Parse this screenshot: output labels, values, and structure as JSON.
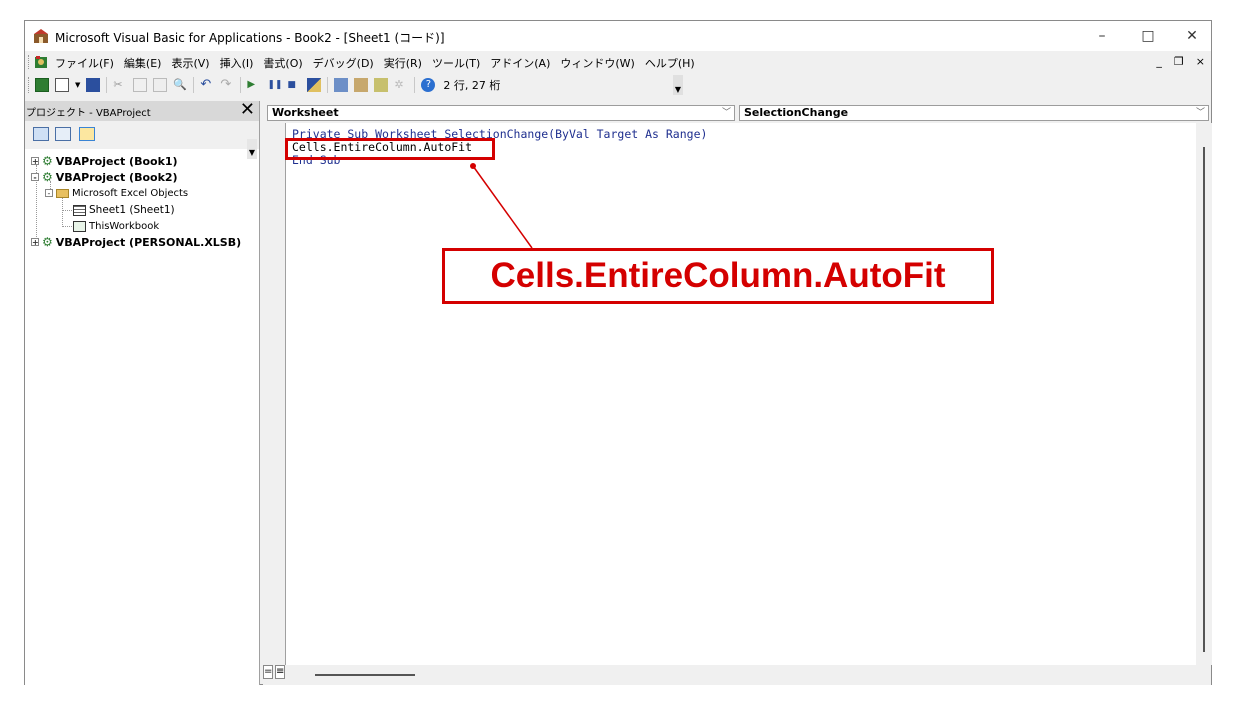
{
  "window": {
    "title": "Microsoft Visual Basic for Applications - Book2 - [Sheet1 (コード)]",
    "minimize": "–",
    "maximize": "□",
    "close": "✕"
  },
  "menu": {
    "items": [
      "ファイル(F)",
      "編集(E)",
      "表示(V)",
      "挿入(I)",
      "書式(O)",
      "デバッグ(D)",
      "実行(R)",
      "ツール(T)",
      "アドイン(A)",
      "ウィンドウ(W)",
      "ヘルプ(H)"
    ],
    "mdi_minimize": "_",
    "mdi_restore": "❐",
    "mdi_close": "×"
  },
  "toolbar": {
    "position_text": "2 行, 27 桁"
  },
  "project": {
    "title": "プロジェクト - VBAProject",
    "close": "✕",
    "tree": [
      {
        "label": "VBAProject (Book1)",
        "expander": "+"
      },
      {
        "label": "VBAProject (Book2)",
        "expander": "-"
      },
      {
        "label": "Microsoft Excel Objects",
        "expander": "-"
      },
      {
        "label": "Sheet1 (Sheet1)"
      },
      {
        "label": "ThisWorkbook"
      },
      {
        "label": "VBAProject (PERSONAL.XLSB)",
        "expander": "+"
      }
    ]
  },
  "code": {
    "object_combo": "Worksheet",
    "procedure_combo": "SelectionChange",
    "line1": "Private Sub Worksheet_SelectionChange(ByVal Target As Range)",
    "line2": "Cells.EntireColumn.AutoFit",
    "line3": "End Sub"
  },
  "annotation": {
    "callout_text": "Cells.EntireColumn.AutoFit",
    "color": "#d40000"
  }
}
